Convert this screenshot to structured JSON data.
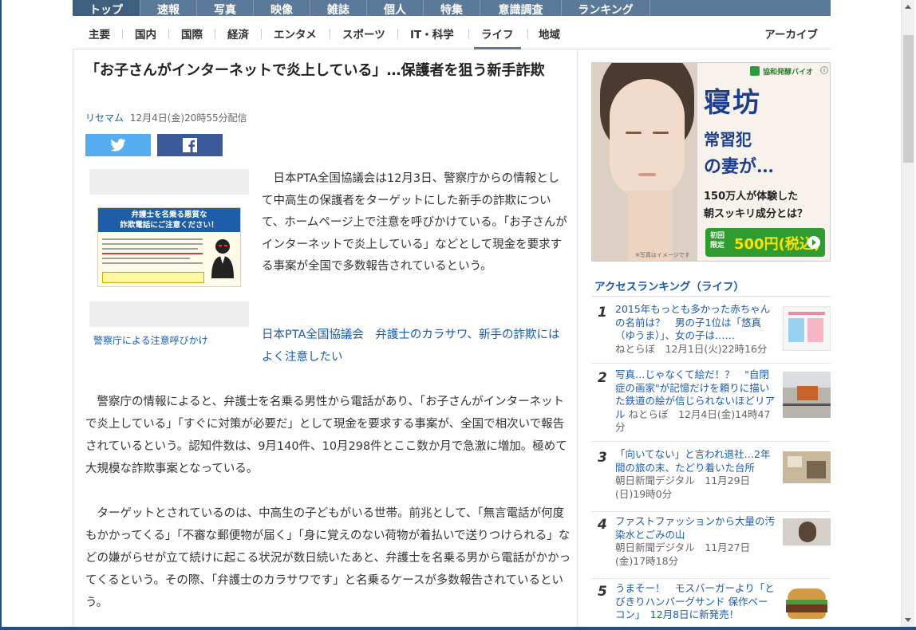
{
  "top_nav": [
    "トップ",
    "速報",
    "写真",
    "映像",
    "雑誌",
    "個人",
    "特集",
    "意識調査",
    "ランキング"
  ],
  "sub_nav": [
    "主要",
    "国内",
    "国際",
    "経済",
    "エンタメ",
    "スポーツ",
    "IT・科学",
    "ライフ",
    "地域"
  ],
  "archive_label": "アーカイブ",
  "article": {
    "title": "「お子さんがインターネットで炎上している」…保護者を狙う新手詐欺",
    "source": "リセマム",
    "date": "12月4日(金)20時55分配信",
    "image_caption": "警察庁による注意呼びかけ",
    "poster_heading": "弁護士を名乗る悪質な\n詐欺電話にご注意ください！",
    "lead": "　日本PTA全国協議会は12月3日、警察庁からの情報として中高生の保護者をターゲットにした新手の詐欺について、ホームページ上で注意を呼びかけている。「お子さんがインターネットで炎上している」などとして現金を要求する事案が全国で多数報告されているという。",
    "related_link": "日本PTA全国協議会　弁護士のカラサワ、新手の詐欺にはよく注意したい",
    "paragraph1": "　警察庁の情報によると、弁護士を名乗る男性から電話があり、「お子さんがインターネットで炎上している」「すぐに対策が必要だ」として現金を要求する事案が、全国で相次いで報告されているという。認知件数は、9月140件、10月298件とここ数か月で急激に増加。極めて大規模な詐欺事案となっている。",
    "paragraph2": "　ターゲットとされているのは、中高生の子どもがいる世帯。前兆として、「無言電話が何度もかかってくる」「不審な郵便物が届く」「身に覚えのない荷物が着払いで送りつけられる」などの嫌がらせが立て続けに起こる状況が数日続いたあと、弁護士を名乗る男から電話がかかってくるという。その際、「弁護士のカラサワです」と名乗るケースが多数報告されているという。"
  },
  "ad": {
    "brand": "協和発酵バイオ",
    "headline": "寝坊",
    "line1": "常習犯",
    "line2": "の妻が…",
    "line3": "150万人が体験した",
    "line4": "朝スッキリ成分とは？",
    "cta_label": "初回\n限定",
    "cta_price": "500円(税込)",
    "note": "※写真はイメージです"
  },
  "ranking": {
    "title": "アクセスランキング（ライフ）",
    "items": [
      {
        "num": "1",
        "title": "2015年もっとも多かった赤ちゃんの名前は？　男の子1位は「悠真（ゆうま）」、女の子は……",
        "source": "ねとらぼ　12月1日(火)22時16分"
      },
      {
        "num": "2",
        "title": "写真…じゃなくて絵だ！？　\"自閉症の画家\"が記憶だけを頼りに描いた鉄道の絵が信じられないほどリアル",
        "source": "ねとらぼ　12月4日(金)14時47分"
      },
      {
        "num": "3",
        "title": "「向いてない」と言われ退社…2年間の旅の末、たどり着いた台所",
        "source": "朝日新聞デジタル　11月29日(日)19時0分"
      },
      {
        "num": "4",
        "title": "ファストファッションから大量の汚染水とごみの山",
        "source": "朝日新聞デジタル　11月27日(金)17時18分"
      },
      {
        "num": "5",
        "title": "うまそー！　モスバーガーより「とびきりハンバーグサンド 保作ベーコン」　12月8日に新発売！",
        "source": ""
      }
    ]
  },
  "colors": {
    "nav_bg": "#5b7a99",
    "link": "#1a5bb0",
    "twitter": "#55acee",
    "facebook": "#3b5998",
    "ad_green": "#2e9c2e",
    "ad_navy": "#1e3f8f"
  }
}
